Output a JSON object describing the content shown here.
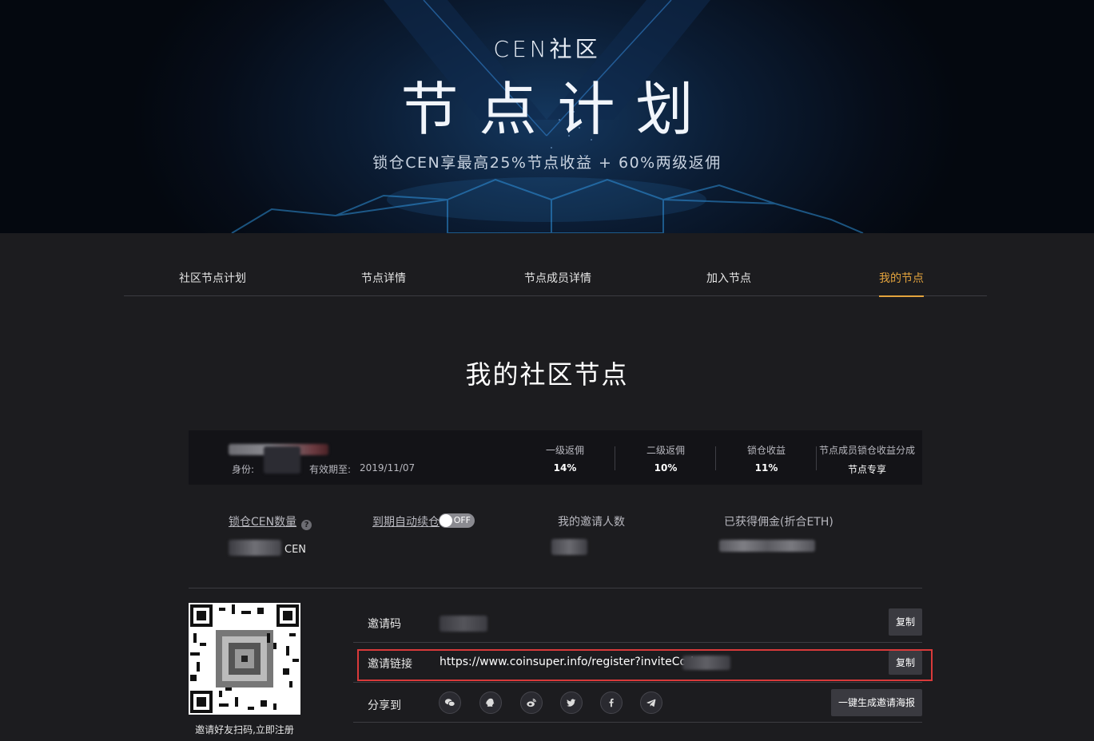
{
  "hero": {
    "subtitle": "CEN社区",
    "title": "节点计划",
    "tagline": "锁仓CEN享最高25%节点收益 + 60%两级返佣"
  },
  "tabs": [
    {
      "label": "社区节点计划",
      "active": false
    },
    {
      "label": "节点详情",
      "active": false
    },
    {
      "label": "节点成员详情",
      "active": false
    },
    {
      "label": "加入节点",
      "active": false
    },
    {
      "label": "我的节点",
      "active": true
    }
  ],
  "page_title": "我的社区节点",
  "info_bar": {
    "identity_label": "身份:",
    "valid_until_label": "有效期至:",
    "valid_until_date": "2019/11/07",
    "stats": [
      {
        "label": "一级返佣",
        "value": "14%"
      },
      {
        "label": "二级返佣",
        "value": "10%"
      },
      {
        "label": "锁仓收益",
        "value": "11%"
      },
      {
        "label": "节点成员锁仓收益分成",
        "value": "节点专享"
      }
    ]
  },
  "summary": {
    "locked_cen_label": "锁仓CEN数量",
    "locked_cen_unit": "CEN",
    "auto_relock_label": "到期自动续仓",
    "auto_relock_state": "OFF",
    "invitees_label": "我的邀请人数",
    "commission_label": "已获得佣金(折合ETH)"
  },
  "qr_caption": "邀请好友扫码,立即注册",
  "invite": {
    "code_label": "邀请码",
    "link_label": "邀请链接",
    "link_value": "https://www.coinsuper.info/register?inviteCode=",
    "copy_label": "复制",
    "share_label": "分享到",
    "poster_label": "一键生成邀请海报",
    "share_icons": [
      "wechat-icon",
      "qq-icon",
      "weibo-icon",
      "twitter-icon",
      "facebook-icon",
      "telegram-icon"
    ]
  },
  "colors": {
    "accent": "#e3a33d",
    "background": "#1c1c1f",
    "panel": "#131317",
    "highlight": "#d93a3a"
  }
}
